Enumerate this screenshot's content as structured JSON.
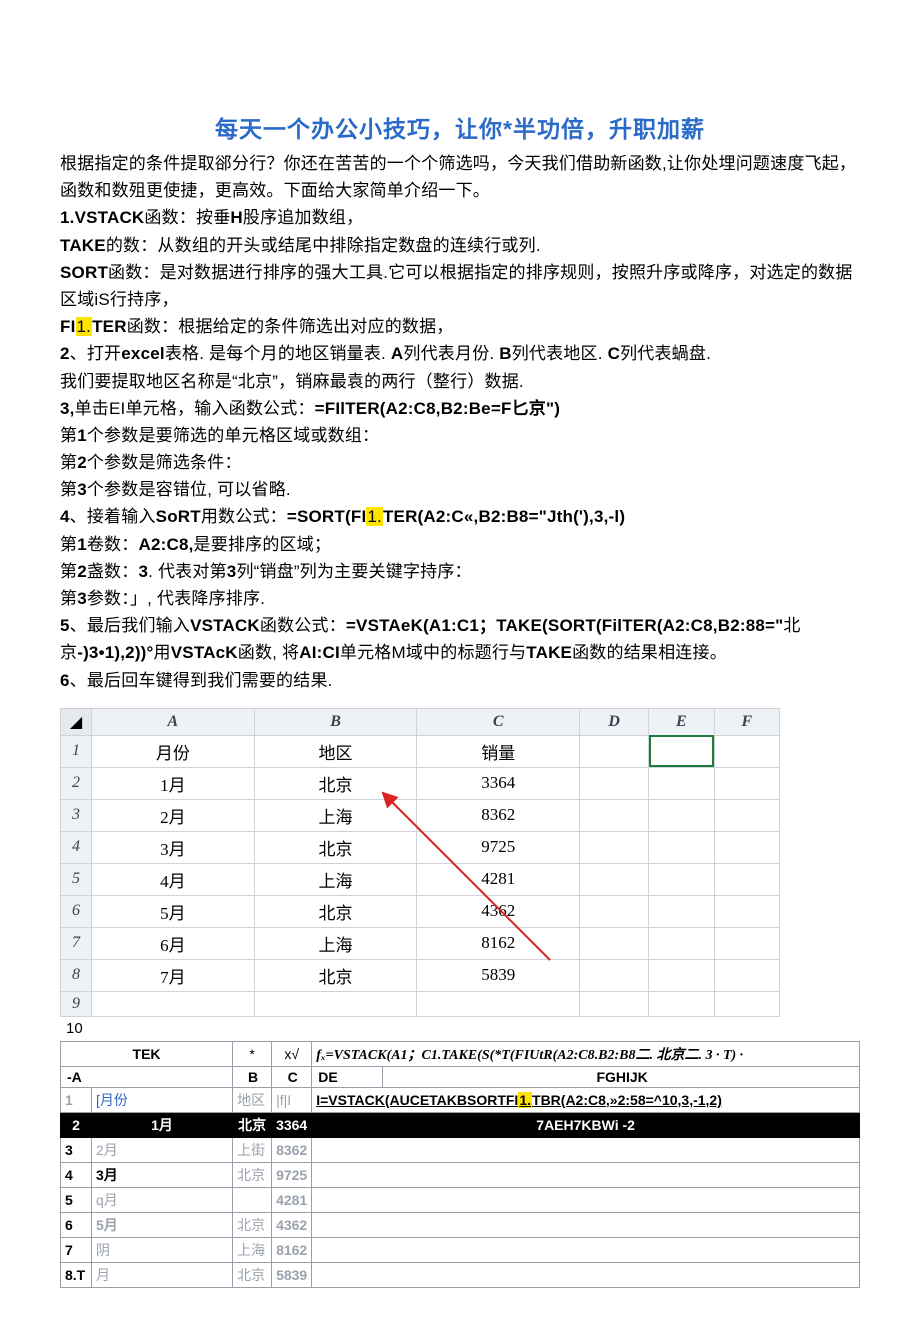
{
  "title": "每天一个办公小技巧，让你*半功倍，升职加薪",
  "intro1": "根据指定的条件提取郤分行？你还在苦苦的一个个筛选吗，今天我们借助新函数,让你处埋问题速度飞起，函数和数殂更使捷，更高效。下面给大家简单介绍一下。",
  "l1a": "1.VSTACK",
  "l1b": "函数：按垂",
  "l1c": "H",
  "l1d": "股序追加数组，",
  "l2a": "TAKE",
  "l2b": "的数：从数组的开头或结尾中排除指定数盘的连续行或列.",
  "l3a": "SORT",
  "l3b": "函数：是对数据进行排序的强大工具.它可以根据指定的排序规则，按照升序或降序，对选定的数据区域iS行持序，",
  "l4a": "FI",
  "l4hl": "1.",
  "l4b": "TER",
  "l4c": "函数：根据给定的条件筛选出对应的数据，",
  "l5a": "2",
  "l5b": "、打开",
  "l5c": "excel",
  "l5d": "表格. 是每个月的地区销量表. ",
  "l5e": "A",
  "l5f": "列代表月份. ",
  "l5g": "B",
  "l5h": "列代表地区. ",
  "l5i": "C",
  "l5j": "列代表蝸盘.",
  "l6": "我们要提取地区名称是“北京”，销麻最袁的两行（整行）数据.",
  "l7a": "3,",
  "l7b": "单击EI单元格，输入函数公式：",
  "l7c": "=FIlTER(A2:C8,B2:Be=F匕京\")",
  "l8a": "第",
  "l8b": "1",
  "l8c": "个参数是要筛选的单元格区域或数组：",
  "l9a": "第",
  "l9b": "2",
  "l9c": "个参数是筛选条件：",
  "l10a": "第",
  "l10b": "3",
  "l10c": "个参数是容错位, 可以省略.",
  "l11a": "4",
  "l11b": "、接着输入",
  "l11c": "SoRT",
  "l11d": "用数公式：",
  "l11e": "=SORT(FI",
  "l11hl": "1.",
  "l11f": "TER(A2:C«,B2:B8=\"Jth('),3,-l)",
  "l12a": "第",
  "l12b": "1",
  "l12c": "卷数：",
  "l12d": "A2:C8,",
  "l12e": "是要排序的区域；",
  "l13a": "第",
  "l13b": "2",
  "l13c": "盏数：",
  "l13d": "3",
  "l13e": ". 代表对第",
  "l13f": "3",
  "l13g": "列“销盘”列为主要关键字持序：",
  "l14a": "第",
  "l14b": "3",
  "l14c": "参数：」, 代表降序排序.",
  "l15a": "5",
  "l15b": "、最后我们输入",
  "l15c": "VSTACK",
  "l15d": "函数公式：",
  "l15e": "=VSTAeK(A1:C1；TAKE(SORT(FilTER(A2:C8,B2:88=\"",
  "l15f": "北京",
  "l15g": "-)3•1),2))°",
  "l15h": "用",
  "l15i": "VSTAcK",
  "l15j": "函数, 将",
  "l15k": "AI:CI",
  "l15l": "单元格M域中的标题行与",
  "l15m": "TAKE",
  "l15n": "函数的结果相连接。",
  "l16a": "6",
  "l16b": "、最后回车键得到我们需要的结果.",
  "sheet1": {
    "cols": [
      "A",
      "B",
      "C",
      "D",
      "E",
      "F"
    ],
    "rows": [
      "1",
      "2",
      "3",
      "4",
      "5",
      "6",
      "7",
      "8",
      "9"
    ],
    "data": [
      [
        "月份",
        "地区",
        "销量",
        "",
        "",
        ""
      ],
      [
        "1月",
        "北京",
        "3364",
        "",
        "",
        ""
      ],
      [
        "2月",
        "上海",
        "8362",
        "",
        "",
        ""
      ],
      [
        "3月",
        "北京",
        "9725",
        "",
        "",
        ""
      ],
      [
        "4月",
        "上海",
        "4281",
        "",
        "",
        ""
      ],
      [
        "5月",
        "北京",
        "4362",
        "",
        "",
        ""
      ],
      [
        "6月",
        "上海",
        "8162",
        "",
        "",
        ""
      ],
      [
        "7月",
        "北京",
        "5839",
        "",
        "",
        ""
      ],
      [
        "",
        "",
        "",
        "",
        "",
        ""
      ]
    ]
  },
  "row10": "10",
  "fbar": {
    "name": "TEK",
    "star": "*",
    "xfx": "x√",
    "formula_fx": "fₓ",
    "formula": "=VSTACK(A1；C1.TAKE(S(*T(FIUtR(A2:C8.B2:B8二. 北京二. 3 · T) ·"
  },
  "grid2": {
    "hdr_a": "-A",
    "hdr_b": "B",
    "hdr_c": "C",
    "hdr_de": "DE",
    "hdr_fghijk": "FGHIJK",
    "row1_num": "1",
    "row1_a": " [月份",
    "row1_b": "地区",
    "row1_c": "|f|I",
    "row1_long": "I=VSTACK(AUCETAKBSORTFI",
    "row1_hl": "1.",
    "row1_long2": "TBR(A2:C8,»2:58=^10,3,-1,2)",
    "black_num": "2",
    "black_a": "1月",
    "black_b": "北京",
    "black_c": "3364",
    "black_txt": "7AEH7KBWi -2",
    "r3n": "3",
    "r3a": "2月",
    "r3b": "上街",
    "r3c": "8362",
    "r4n": "4",
    "r4a": "3月",
    "r4b": "北京",
    "r4c": "9725",
    "r5n": "5",
    "r5a": "q月",
    "r5c": "4281",
    "r6n": "6",
    "r6a": "5月",
    "r6b": "北京",
    "r6c": "4362",
    "r7n": "7",
    "r7a": "阴",
    "r7b": "上海",
    "r7c": "8162",
    "r8n": "8.T",
    "r8a": "月",
    "r8b": "北京",
    "r8c": "5839"
  }
}
